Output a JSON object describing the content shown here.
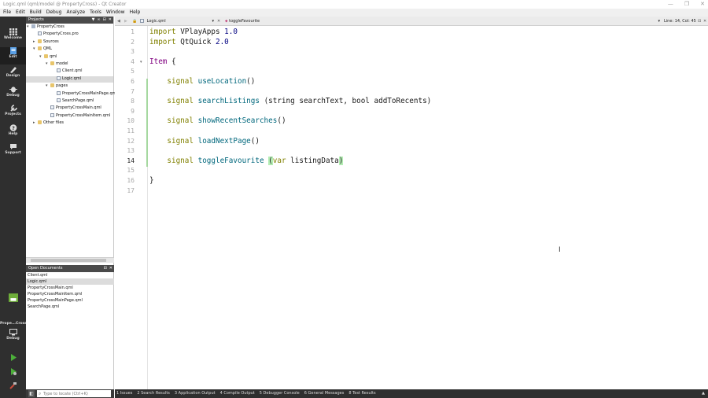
{
  "window": {
    "title": "Logic.qml (qml/model @ PropertyCross) - Qt Creator",
    "controls": [
      "—",
      "❐",
      "✕"
    ]
  },
  "menu": [
    "File",
    "Edit",
    "Build",
    "Debug",
    "Analyze",
    "Tools",
    "Window",
    "Help"
  ],
  "modes": [
    {
      "label": "Welcome",
      "icon": "welcome-icon"
    },
    {
      "label": "Edit",
      "icon": "edit-icon"
    },
    {
      "label": "Design",
      "icon": "design-icon"
    },
    {
      "label": "Debug",
      "icon": "debug-icon"
    },
    {
      "label": "Projects",
      "icon": "projects-icon"
    },
    {
      "label": "Help",
      "icon": "help-icon"
    },
    {
      "label": "Support",
      "icon": "support-icon"
    }
  ],
  "kit": {
    "label": "Prope...Cross",
    "config": "Debug"
  },
  "navigator": {
    "header": "Projects",
    "tree": [
      {
        "label": "PropertyCross",
        "kind": "proj",
        "depth": 0,
        "arrow": "▾"
      },
      {
        "label": "PropertyCross.pro",
        "kind": "file",
        "depth": 1,
        "arrow": ""
      },
      {
        "label": "Sources",
        "kind": "folder",
        "depth": 1,
        "arrow": "▸"
      },
      {
        "label": "QML",
        "kind": "folder",
        "depth": 1,
        "arrow": "▾"
      },
      {
        "label": "qml",
        "kind": "folder",
        "depth": 2,
        "arrow": "▾"
      },
      {
        "label": "model",
        "kind": "folder",
        "depth": 3,
        "arrow": "▾"
      },
      {
        "label": "Client.qml",
        "kind": "file",
        "depth": 4,
        "arrow": ""
      },
      {
        "label": "Logic.qml",
        "kind": "file",
        "depth": 4,
        "arrow": "",
        "selected": true
      },
      {
        "label": "pages",
        "kind": "folder",
        "depth": 3,
        "arrow": "▾"
      },
      {
        "label": "PropertyCrossMainPage.qml",
        "kind": "file",
        "depth": 4,
        "arrow": ""
      },
      {
        "label": "SearchPage.qml",
        "kind": "file",
        "depth": 4,
        "arrow": ""
      },
      {
        "label": "PropertyCrossMain.qml",
        "kind": "file",
        "depth": 3,
        "arrow": ""
      },
      {
        "label": "PropertyCrossMainItem.qml",
        "kind": "file",
        "depth": 3,
        "arrow": ""
      },
      {
        "label": "Other files",
        "kind": "folder",
        "depth": 1,
        "arrow": "▸"
      }
    ]
  },
  "open_documents": {
    "header": "Open Documents",
    "items": [
      {
        "label": "Client.qml"
      },
      {
        "label": "Logic.qml",
        "selected": true
      },
      {
        "label": "PropertyCrossMain.qml"
      },
      {
        "label": "PropertyCrossMainItem.qml"
      },
      {
        "label": "PropertyCrossMainPage.qml"
      },
      {
        "label": "SearchPage.qml"
      }
    ]
  },
  "locator": {
    "placeholder": "Type to locate (Ctrl+K)"
  },
  "editor": {
    "file": "Logic.qml",
    "symbol": "toggleFavourite",
    "position": "Line: 14, Col: 45",
    "current_line": 14
  },
  "code": [
    {
      "n": "1",
      "html": "<span class='kw'>import</span> VPlayApps <span class='num'>1.0</span>"
    },
    {
      "n": "2",
      "html": "<span class='kw'>import</span> QtQuick <span class='num'>2.0</span>"
    },
    {
      "n": "3",
      "html": ""
    },
    {
      "n": "4",
      "html": "<span class='ty'>Item</span> {",
      "fold": true
    },
    {
      "n": "5",
      "html": ""
    },
    {
      "n": "6",
      "html": "    <span class='kw'>signal</span> <span class='fn'>useLocation</span>()"
    },
    {
      "n": "7",
      "html": ""
    },
    {
      "n": "8",
      "html": "    <span class='kw'>signal</span> <span class='fn'>searchListings</span> (string searchText, bool addToRecents)"
    },
    {
      "n": "9",
      "html": ""
    },
    {
      "n": "10",
      "html": "    <span class='kw'>signal</span> <span class='fn'>showRecentSearches</span>()"
    },
    {
      "n": "11",
      "html": ""
    },
    {
      "n": "12",
      "html": "    <span class='kw'>signal</span> <span class='fn'>loadNextPage</span>()"
    },
    {
      "n": "13",
      "html": ""
    },
    {
      "n": "14",
      "html": "    <span class='kw'>signal</span> <span class='fn'>toggleFavourite</span> <span class='paren-hl'>(</span><span class='var-kw'>var</span> listingData<span class='paren-hl'>)</span>"
    },
    {
      "n": "15",
      "html": ""
    },
    {
      "n": "16",
      "html": "}"
    },
    {
      "n": "17",
      "html": ""
    }
  ],
  "output_panes": [
    "1 Issues",
    "2 Search Results",
    "3 Application Output",
    "4 Compile Output",
    "5 Debugger Console",
    "6 General Messages",
    "8 Test Results"
  ]
}
